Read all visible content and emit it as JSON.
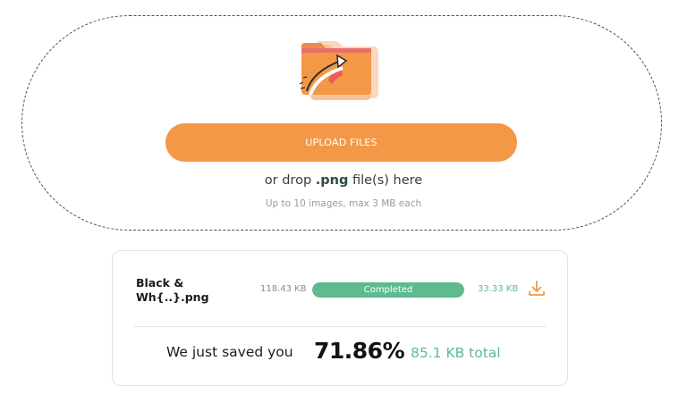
{
  "upload": {
    "button_label": "UPLOAD FILES",
    "drop_prefix": "or drop ",
    "drop_ext": ".png",
    "drop_suffix": " file(s) here",
    "limits": "Up to 10 images, max 3 MB each"
  },
  "result": {
    "file_name": "Black & Wh{..}.png",
    "original_size": "118.43 KB",
    "status": "Completed",
    "progress_percent": 100,
    "new_size": "33.33 KB",
    "saved_label": "We just saved you",
    "saved_percent": "71.86%",
    "saved_total": "85.1 KB total"
  },
  "icons": {
    "folder": "folder-upload-icon",
    "download": "download-icon"
  },
  "colors": {
    "accent_orange": "#f39847",
    "success_green": "#5dbb8f",
    "dashed_border": "#3e5a55"
  }
}
